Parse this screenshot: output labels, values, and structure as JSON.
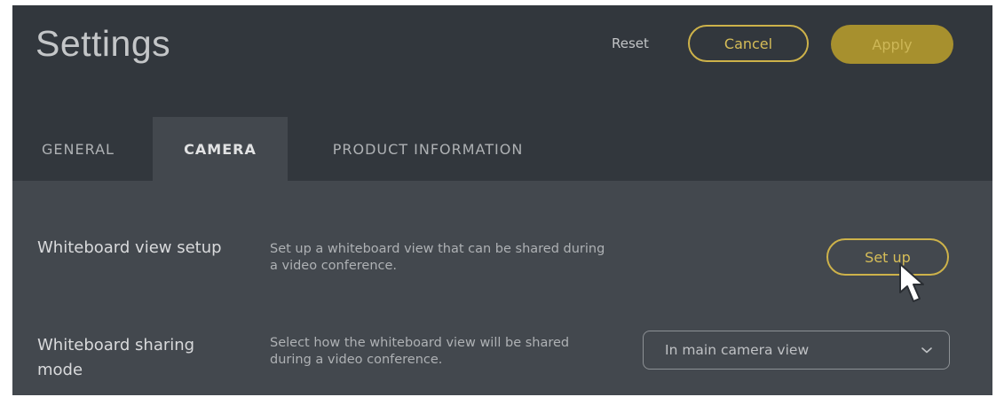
{
  "header": {
    "title": "Settings",
    "reset_label": "Reset",
    "cancel_label": "Cancel",
    "apply_label": "Apply"
  },
  "tabs": [
    {
      "label": "GENERAL",
      "active": false
    },
    {
      "label": "CAMERA",
      "active": true
    },
    {
      "label": "PRODUCT INFORMATION",
      "active": false
    }
  ],
  "rows": [
    {
      "label": "Whiteboard view setup",
      "description": "Set up a whiteboard view that can be shared during a video conference.",
      "action_label": "Set up"
    },
    {
      "label": "Whiteboard sharing mode",
      "description": "Select how the whiteboard view will be shared during a video conference.",
      "selected_option": "In main camera view"
    }
  ],
  "icons": {
    "cursor": "mouse-pointer-icon",
    "dropdown": "chevron-down-icon"
  },
  "colors": {
    "background": "#43484e",
    "header_background": "#32373d",
    "accent": "#cdb24a",
    "apply_fill": "#a7902e"
  }
}
